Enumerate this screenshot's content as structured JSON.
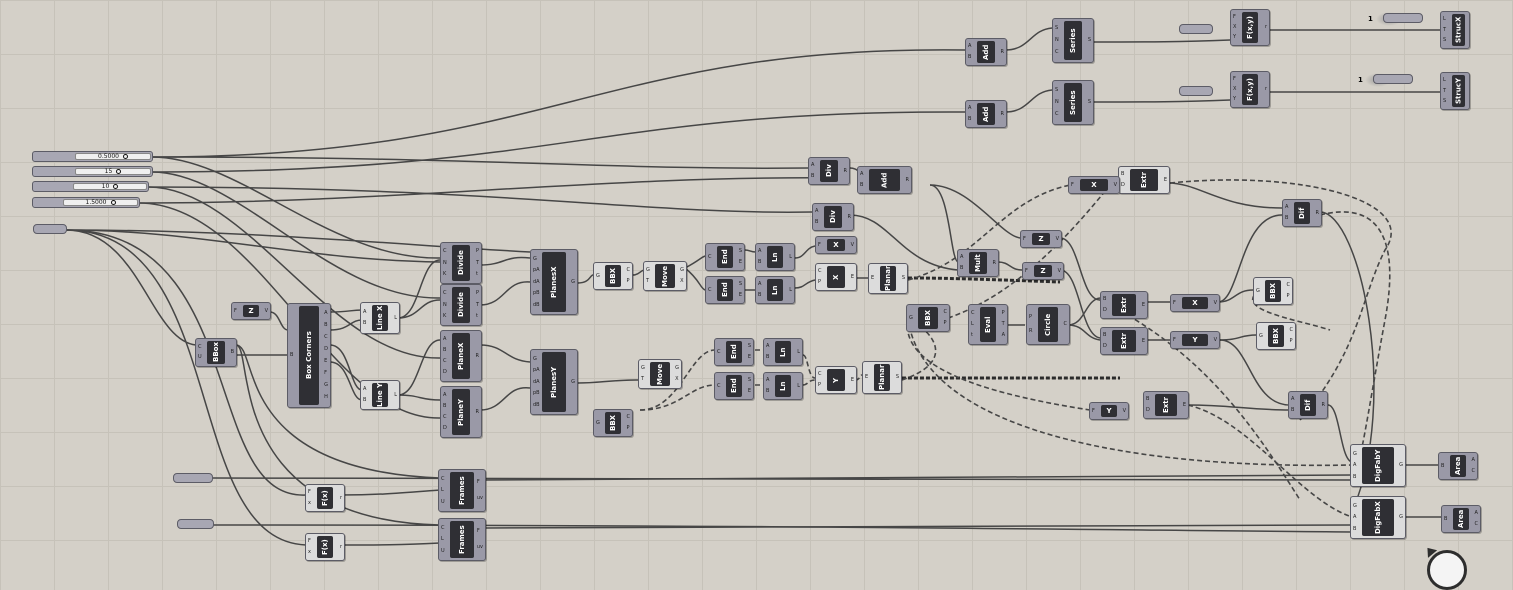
{
  "sliders": [
    {
      "value": "0.5000"
    },
    {
      "value": "15"
    },
    {
      "value": "10"
    },
    {
      "value": "1.5000"
    }
  ],
  "components": {
    "add_top": {
      "title": "Add",
      "inputs": [
        "A",
        "B"
      ],
      "outputs": [
        "R"
      ]
    },
    "add_mid": {
      "title": "Add",
      "inputs": [
        "A",
        "B"
      ],
      "outputs": [
        "R"
      ]
    },
    "series_top": {
      "title": "Series",
      "inputs": [
        "S",
        "N",
        "C"
      ],
      "outputs": [
        "S"
      ]
    },
    "series_mid": {
      "title": "Series",
      "inputs": [
        "S",
        "N",
        "C"
      ],
      "outputs": [
        "S"
      ]
    },
    "fxy_top": {
      "title": "F(x,y)",
      "inputs": [
        "F",
        "X",
        "Y"
      ],
      "outputs": [
        "r"
      ]
    },
    "fxy_mid": {
      "title": "F(x,y)",
      "inputs": [
        "F",
        "X",
        "Y"
      ],
      "outputs": [
        "r"
      ]
    },
    "struct_x": {
      "title": "StrucX",
      "inputs": [
        "L",
        "T",
        "S"
      ],
      "outputs": []
    },
    "struct_y": {
      "title": "StrucY",
      "inputs": [
        "L",
        "T",
        "S"
      ],
      "outputs": []
    },
    "div1": {
      "title": "Div",
      "inputs": [
        "A",
        "B"
      ],
      "outputs": [
        "R"
      ]
    },
    "add3": {
      "title": "Add",
      "inputs": [
        "A",
        "B"
      ],
      "outputs": [
        "R"
      ]
    },
    "div2": {
      "title": "Div",
      "inputs": [
        "A",
        "B"
      ],
      "outputs": [
        "R"
      ]
    },
    "x_vec1": {
      "title": "X",
      "inputs": [
        "F"
      ],
      "outputs": [
        "V"
      ]
    },
    "x_vec2": {
      "title": "X",
      "inputs": [
        "C",
        "P"
      ],
      "outputs": [
        "E"
      ]
    },
    "extr_top": {
      "title": "Extr",
      "inputs": [
        "B",
        "D"
      ],
      "outputs": [
        "E"
      ]
    },
    "x_top": {
      "title": "X",
      "inputs": [
        "F"
      ],
      "outputs": [
        "V"
      ]
    },
    "dif_top": {
      "title": "Dif",
      "inputs": [
        "A",
        "B"
      ],
      "outputs": [
        "R"
      ]
    },
    "z_vec1": {
      "title": "Z",
      "inputs": [
        "F"
      ],
      "outputs": [
        "V"
      ]
    },
    "z_vec2": {
      "title": "Z",
      "inputs": [
        "F"
      ],
      "outputs": [
        "V"
      ]
    },
    "mult": {
      "title": "Mult",
      "inputs": [
        "A",
        "B"
      ],
      "outputs": [
        "R"
      ]
    },
    "bbox": {
      "title": "BBox",
      "inputs": [
        "C",
        "U"
      ],
      "outputs": [
        "B"
      ]
    },
    "z_small": {
      "title": "Z",
      "inputs": [
        "F"
      ],
      "outputs": [
        "V"
      ]
    },
    "box_corners": {
      "title": "Box Corners",
      "inputs": [
        "B"
      ],
      "outputs": [
        "A",
        "B",
        "C",
        "D",
        "E",
        "F",
        "G",
        "H"
      ]
    },
    "line_x": {
      "title": "Line X",
      "inputs": [
        "A",
        "B"
      ],
      "outputs": [
        "L"
      ]
    },
    "line_y": {
      "title": "Line Y",
      "inputs": [
        "A",
        "B"
      ],
      "outputs": [
        "L"
      ]
    },
    "divide1": {
      "title": "Divide",
      "inputs": [
        "C",
        "N",
        "K"
      ],
      "outputs": [
        "P",
        "T",
        "t"
      ]
    },
    "divide2": {
      "title": "Divide",
      "inputs": [
        "C",
        "N",
        "K"
      ],
      "outputs": [
        "P",
        "T",
        "t"
      ]
    },
    "plane_x1": {
      "title": "PlaneX",
      "inputs": [
        "A",
        "B",
        "C",
        "D"
      ],
      "outputs": [
        "R"
      ]
    },
    "plane_y1": {
      "title": "PlaneY",
      "inputs": [
        "A",
        "B",
        "C",
        "D"
      ],
      "outputs": [
        "R"
      ]
    },
    "planes_x": {
      "title": "PlanesX",
      "inputs": [
        "G",
        "pA",
        "dA",
        "pB",
        "dB"
      ],
      "outputs": [
        "G"
      ]
    },
    "planes_y": {
      "title": "PlanesY",
      "inputs": [
        "G",
        "pA",
        "dA",
        "pB",
        "dB"
      ],
      "outputs": [
        "G"
      ]
    },
    "bbx1": {
      "title": "BBX",
      "inputs": [
        "G"
      ],
      "outputs": [
        "C",
        "P"
      ]
    },
    "bbx2": {
      "title": "BBX",
      "inputs": [
        "G"
      ],
      "outputs": [
        "C",
        "P"
      ]
    },
    "move1": {
      "title": "Move",
      "inputs": [
        "G",
        "T"
      ],
      "outputs": [
        "G",
        "X"
      ]
    },
    "move2": {
      "title": "Move",
      "inputs": [
        "G",
        "T"
      ],
      "outputs": [
        "G",
        "X"
      ]
    },
    "end1": {
      "title": "End",
      "inputs": [
        "C"
      ],
      "outputs": [
        "S",
        "E"
      ]
    },
    "end2": {
      "title": "End",
      "inputs": [
        "C"
      ],
      "outputs": [
        "S",
        "E"
      ]
    },
    "end3": {
      "title": "End",
      "inputs": [
        "C"
      ],
      "outputs": [
        "S",
        "E"
      ]
    },
    "end4": {
      "title": "End",
      "inputs": [
        "C"
      ],
      "outputs": [
        "S",
        "E"
      ]
    },
    "ln1": {
      "title": "Ln",
      "inputs": [
        "A",
        "B"
      ],
      "outputs": [
        "L"
      ]
    },
    "ln2": {
      "title": "Ln",
      "inputs": [
        "A",
        "B"
      ],
      "outputs": [
        "L"
      ]
    },
    "ln3": {
      "title": "Ln",
      "inputs": [
        "A",
        "B"
      ],
      "outputs": [
        "L"
      ]
    },
    "ln4": {
      "title": "Ln",
      "inputs": [
        "A",
        "B"
      ],
      "outputs": [
        "L"
      ]
    },
    "y_vec": {
      "title": "Y",
      "inputs": [
        "C",
        "P"
      ],
      "outputs": [
        "E"
      ]
    },
    "planar1": {
      "title": "Planar",
      "inputs": [
        "E"
      ],
      "outputs": [
        "S"
      ]
    },
    "planar2": {
      "title": "Planar",
      "inputs": [
        "E"
      ],
      "outputs": [
        "S"
      ]
    },
    "bbx3": {
      "title": "BBX",
      "inputs": [
        "G"
      ],
      "outputs": [
        "C",
        "P"
      ]
    },
    "eval": {
      "title": "Eval",
      "inputs": [
        "C",
        "L",
        "t"
      ],
      "outputs": [
        "P",
        "T",
        "A"
      ]
    },
    "circle": {
      "title": "Circle",
      "inputs": [
        "P",
        "R"
      ],
      "outputs": [
        "C"
      ]
    },
    "extr_a": {
      "title": "Extr",
      "inputs": [
        "B",
        "D"
      ],
      "outputs": [
        "E"
      ]
    },
    "extr_b": {
      "title": "Extr",
      "inputs": [
        "B",
        "D"
      ],
      "outputs": [
        "E"
      ]
    },
    "x_c": {
      "title": "X",
      "inputs": [
        "F"
      ],
      "outputs": [
        "V"
      ]
    },
    "y_c": {
      "title": "Y",
      "inputs": [
        "F"
      ],
      "outputs": [
        "V"
      ]
    },
    "bbx4": {
      "title": "BBX",
      "inputs": [
        "G"
      ],
      "outputs": [
        "C",
        "P"
      ]
    },
    "bbx5": {
      "title": "BBX",
      "inputs": [
        "G"
      ],
      "outputs": [
        "C",
        "P"
      ]
    },
    "y_low": {
      "title": "Y",
      "inputs": [
        "F"
      ],
      "outputs": [
        "V"
      ]
    },
    "extr_low": {
      "title": "Extr",
      "inputs": [
        "B",
        "D"
      ],
      "outputs": [
        "E"
      ]
    },
    "dif_low": {
      "title": "Dif",
      "inputs": [
        "A",
        "B"
      ],
      "outputs": [
        "R"
      ]
    },
    "digfab_y": {
      "title": "DigFabY",
      "inputs": [
        "G",
        "A",
        "B"
      ],
      "outputs": [
        "G"
      ]
    },
    "digfab_x": {
      "title": "DigFabX",
      "inputs": [
        "G",
        "A",
        "B"
      ],
      "outputs": [
        "G"
      ]
    },
    "area1": {
      "title": "Area",
      "inputs": [
        "B"
      ],
      "outputs": [
        "A",
        "C"
      ]
    },
    "area2": {
      "title": "Area",
      "inputs": [
        "B"
      ],
      "outputs": [
        "A",
        "C"
      ]
    },
    "frames1": {
      "title": "Frames",
      "inputs": [
        "C",
        "L",
        "U"
      ],
      "outputs": [
        "F",
        "uv"
      ]
    },
    "frames2": {
      "title": "Frames",
      "inputs": [
        "C",
        "L",
        "U"
      ],
      "outputs": [
        "F",
        "uv"
      ]
    },
    "fx1": {
      "title": "F(x)",
      "inputs": [
        "F",
        "x"
      ],
      "outputs": [
        "r"
      ]
    },
    "fx2": {
      "title": "F(x)",
      "inputs": [
        "F",
        "x"
      ],
      "outputs": [
        "r"
      ]
    }
  },
  "constants": {
    "one_a": "1",
    "one_b": "1"
  }
}
